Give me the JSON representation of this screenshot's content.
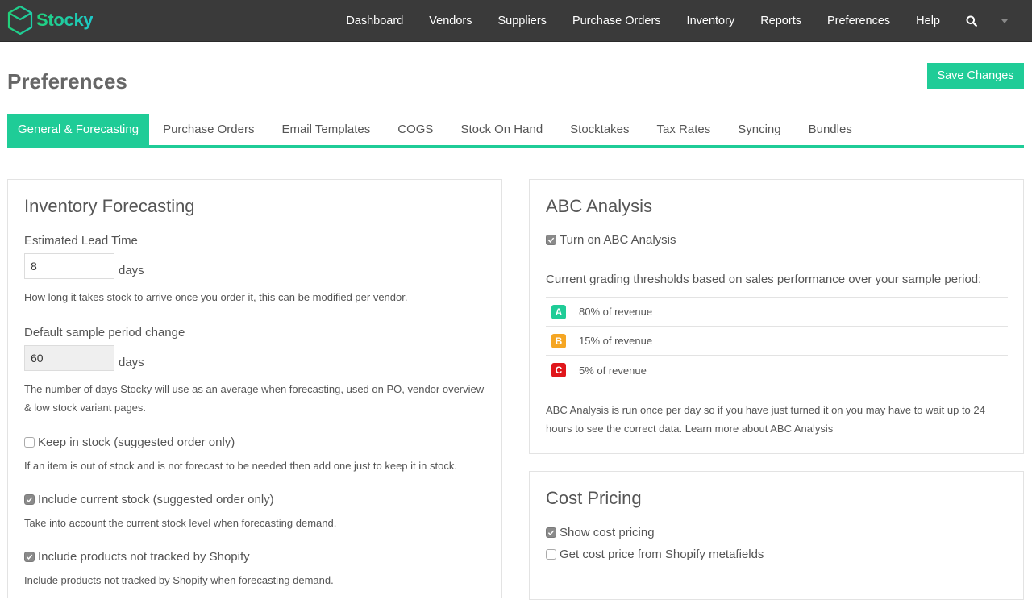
{
  "app": {
    "name": "Stocky",
    "brand_color": "#1fcc97"
  },
  "nav": {
    "items": [
      "Dashboard",
      "Vendors",
      "Suppliers",
      "Purchase Orders",
      "Inventory",
      "Reports",
      "Preferences",
      "Help"
    ],
    "search_icon": "search-icon",
    "account_menu_icon": "caret-down-icon"
  },
  "header": {
    "title": "Preferences",
    "save_label": "Save Changes"
  },
  "tabs": [
    {
      "label": "General & Forecasting",
      "active": true
    },
    {
      "label": "Purchase Orders",
      "active": false
    },
    {
      "label": "Email Templates",
      "active": false
    },
    {
      "label": "COGS",
      "active": false
    },
    {
      "label": "Stock On Hand",
      "active": false
    },
    {
      "label": "Stocktakes",
      "active": false
    },
    {
      "label": "Tax Rates",
      "active": false
    },
    {
      "label": "Syncing",
      "active": false
    },
    {
      "label": "Bundles",
      "active": false
    }
  ],
  "forecasting": {
    "title": "Inventory Forecasting",
    "lead_time": {
      "label": "Estimated Lead Time",
      "value": "8",
      "unit": "days",
      "help": "How long it takes stock to arrive once you order it, this can be modified per vendor."
    },
    "sample_period": {
      "label": "Default sample period",
      "change_link": "change",
      "value": "60",
      "unit": "days",
      "help_line1": "The number of days Stocky will use as an average when forecasting, used on PO, vendor overview",
      "help_line2": "& low stock variant pages."
    },
    "keep_in_stock": {
      "label": "Keep in stock (suggested order only)",
      "checked": false,
      "help": "If an item is out of stock and is not forecast to be needed then add one just to keep it in stock."
    },
    "include_current_stock": {
      "label": "Include current stock (suggested order only)",
      "checked": true,
      "help": "Take into account the current stock level when forecasting demand."
    },
    "include_untracked": {
      "label": "Include products not tracked by Shopify",
      "checked": true,
      "help": "Include products not tracked by Shopify when forecasting demand."
    }
  },
  "abc": {
    "title": "ABC Analysis",
    "toggle_label": "Turn on ABC Analysis",
    "toggle_checked": true,
    "thresholds_intro": "Current grading thresholds based on sales performance over your sample period:",
    "grades": [
      {
        "grade": "A",
        "text": "80% of revenue",
        "color": "#1fcc97"
      },
      {
        "grade": "B",
        "text": "15% of revenue",
        "color": "#f5a623"
      },
      {
        "grade": "C",
        "text": "5% of revenue",
        "color": "#e0161b"
      }
    ],
    "note_line1": "ABC Analysis is run once per day so if you have just turned it on you may have to wait up to 24",
    "note_line2": "hours to see the correct data.",
    "learn_more": "Learn more about ABC Analysis"
  },
  "cost": {
    "title": "Cost Pricing",
    "show_cost_label": "Show cost pricing",
    "show_cost_checked": true,
    "metafields_label": "Get cost price from Shopify metafields",
    "metafields_checked": false
  }
}
